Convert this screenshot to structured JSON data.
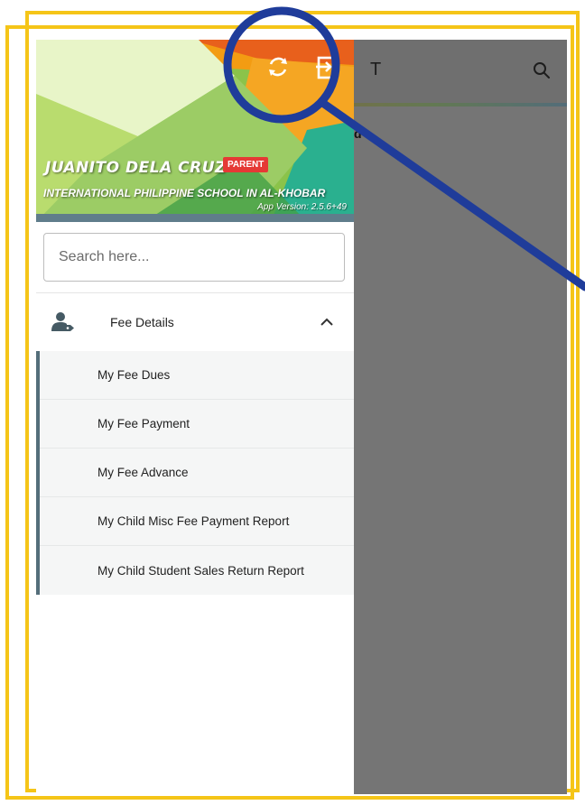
{
  "background_screen": {
    "title_fragment": "T",
    "text_fragment": "d",
    "search_icon": "search-icon"
  },
  "drawer": {
    "header": {
      "sync_icon": "sync-icon",
      "logout_icon": "logout-icon",
      "user_name": "JUANITO DELA CRUZ",
      "role_badge": "PARENT",
      "school": "INTERNATIONAL PHILIPPINE SCHOOL IN AL-KHOBAR",
      "app_version": "App Version: 2.5.6+49"
    },
    "search": {
      "placeholder": "Search here...",
      "value": ""
    },
    "menu": {
      "section": {
        "icon": "user-tag-icon",
        "label": "Fee Details",
        "expanded_icon": "chevron-up-icon"
      },
      "items": [
        {
          "label": "My Fee Dues"
        },
        {
          "label": "My Fee Payment"
        },
        {
          "label": "My Fee Advance"
        },
        {
          "label": "My Child Misc Fee Payment Report"
        },
        {
          "label": "My Child Student Sales Return Report"
        }
      ]
    }
  },
  "colors": {
    "annotation_frame": "#f5c518",
    "highlight_circle": "#1f3c9a",
    "accent_bar": "#546e7a",
    "badge": "#e53935"
  }
}
